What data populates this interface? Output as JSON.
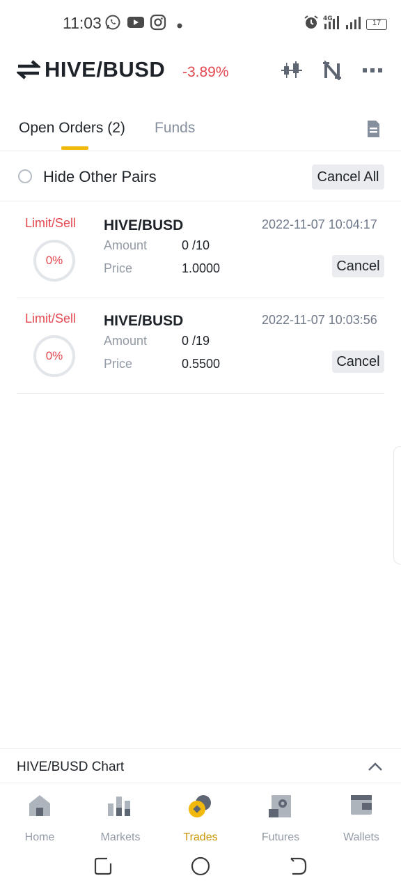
{
  "status_bar": {
    "time": "11:03",
    "icons": [
      "whatsapp-icon",
      "youtube-icon",
      "instagram-icon",
      "dot-icon",
      "alarm-icon",
      "signal-4g-icon",
      "signal-icon",
      "battery-icon"
    ],
    "network": "4G",
    "battery": "17"
  },
  "header": {
    "pair": "HIVE/BUSD",
    "change": "-3.89%",
    "change_color": "#e5474f",
    "actions": [
      "candlestick-icon",
      "indicator-icon",
      "more-icon"
    ]
  },
  "tabs": {
    "open_orders": "Open Orders (2)",
    "funds": "Funds",
    "accent": "#f0b90b"
  },
  "filter": {
    "hide_label": "Hide Other Pairs",
    "cancel_all": "Cancel All"
  },
  "orders": [
    {
      "type": "Limit/Sell",
      "filled_pct": "0%",
      "pair": "HIVE/BUSD",
      "time": "2022-11-07 10:04:17",
      "amount_label": "Amount",
      "amount": "0 /10",
      "price_label": "Price",
      "price": "1.0000",
      "cancel": "Cancel"
    },
    {
      "type": "Limit/Sell",
      "filled_pct": "0%",
      "pair": "HIVE/BUSD",
      "time": "2022-11-07 10:03:56",
      "amount_label": "Amount",
      "amount": "0 /19",
      "price_label": "Price",
      "price": "0.5500",
      "cancel": "Cancel"
    }
  ],
  "chart_bar": {
    "label": "HIVE/BUSD Chart"
  },
  "bottom_nav": [
    {
      "label": "Home",
      "icon": "home-icon",
      "active": false
    },
    {
      "label": "Markets",
      "icon": "markets-icon",
      "active": false
    },
    {
      "label": "Trades",
      "icon": "trades-icon",
      "active": true
    },
    {
      "label": "Futures",
      "icon": "futures-icon",
      "active": false
    },
    {
      "label": "Wallets",
      "icon": "wallet-icon",
      "active": false
    }
  ],
  "system_nav": [
    "recents-icon",
    "home-circle-icon",
    "back-icon"
  ]
}
